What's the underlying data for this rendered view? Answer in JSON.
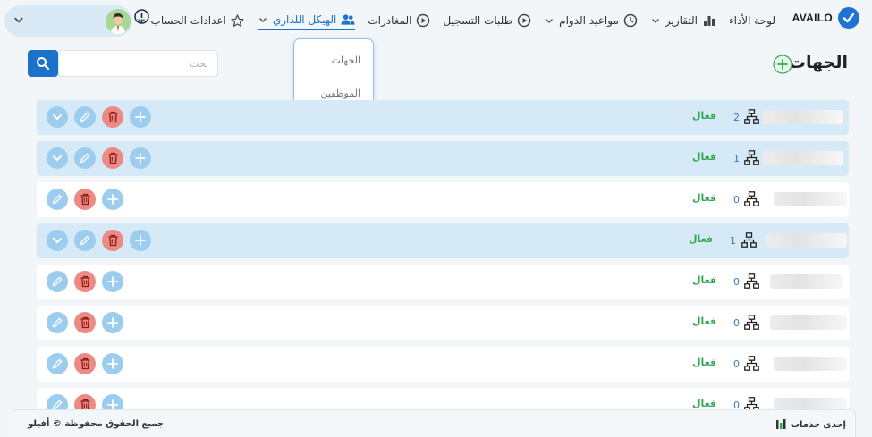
{
  "brand": {
    "name": "AVAILO",
    "color": "#1e73d6"
  },
  "nav": {
    "items": [
      {
        "label": "لوحة الأداء",
        "icon": "none",
        "has_chevron": false
      },
      {
        "label": "التقارير",
        "icon": "bar-chart-icon",
        "has_chevron": true
      },
      {
        "label": "مواعيد الدوام",
        "icon": "clock-icon",
        "has_chevron": true
      },
      {
        "label": "طلبات التسجيل",
        "icon": "play-circle-icon",
        "has_chevron": false
      },
      {
        "label": "المغادرات",
        "icon": "play-circle-icon",
        "has_chevron": false
      },
      {
        "label": "الهيكل اللداري",
        "icon": "users-icon",
        "has_chevron": true,
        "active": true
      },
      {
        "label": "اعدادات الحساب",
        "icon": "star-icon",
        "has_chevron": true
      }
    ],
    "active_color": "#1a73c9"
  },
  "dropdown": {
    "items": [
      "الجهات",
      "الموظفين"
    ]
  },
  "page": {
    "title": "الجهات"
  },
  "search": {
    "placeholder": "بحث"
  },
  "rows": [
    {
      "count": "2",
      "status": "فعال",
      "is_parent": true
    },
    {
      "count": "1",
      "status": "فعال",
      "is_parent": true
    },
    {
      "count": "0",
      "status": "فعال",
      "is_parent": false
    },
    {
      "count": "1",
      "status": "فعال",
      "is_parent": true
    },
    {
      "count": "0",
      "status": "فعال",
      "is_parent": false
    },
    {
      "count": "0",
      "status": "فعال",
      "is_parent": false
    },
    {
      "count": "0",
      "status": "فعال",
      "is_parent": false
    },
    {
      "count": "0",
      "status": "فعال",
      "is_parent": false
    }
  ],
  "colors": {
    "status_active": "#34a853",
    "delete": "#ec8b86",
    "action": "#9dcdee",
    "parent_row": "#d5e9f6"
  },
  "footer": {
    "copyright": "جميع الحقوق محفوظة © أفيلو",
    "company": "إحدى خدمات"
  }
}
